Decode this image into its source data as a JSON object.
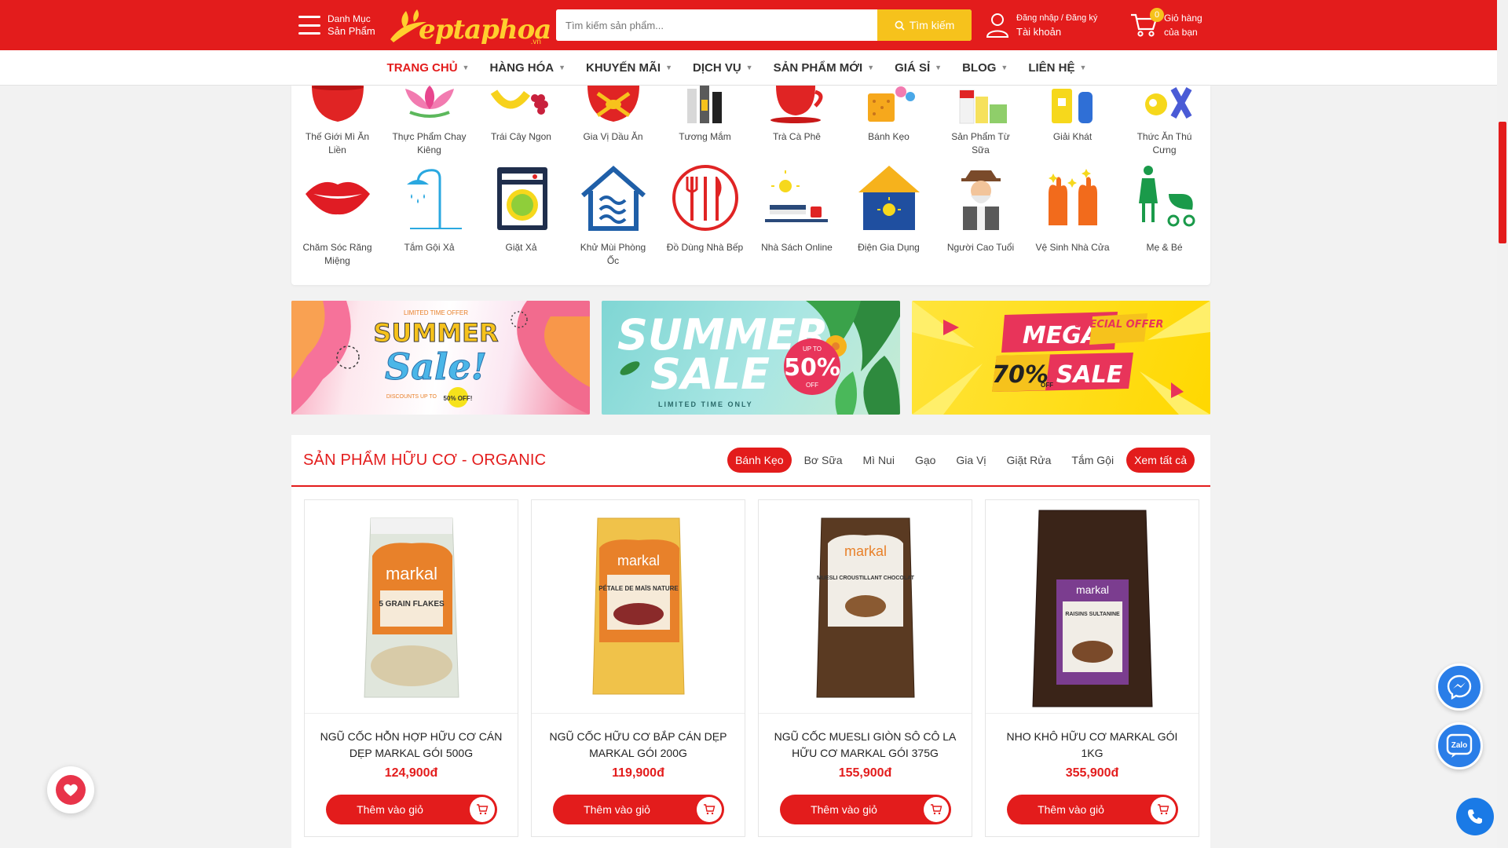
{
  "header": {
    "menu_line1": "Danh Mục",
    "menu_line2": "Sản Phẩm",
    "logo_text": "eptaphoa",
    "logo_suffix": ".vn",
    "search_placeholder": "Tìm kiếm sản phẩm...",
    "search_button": "Tìm kiếm",
    "account_line1": "Đăng nhập / Đăng ký",
    "account_line2": "Tài khoản",
    "cart_count": "0",
    "cart_line1": "Giỏ hàng",
    "cart_line2": "của bạn"
  },
  "nav": {
    "items": [
      {
        "label": "TRANG CHỦ"
      },
      {
        "label": "HÀNG HÓA"
      },
      {
        "label": "KHUYẾN MÃI"
      },
      {
        "label": "DỊCH VỤ"
      },
      {
        "label": "SẢN PHẨM MỚI"
      },
      {
        "label": "GIÁ SỈ"
      },
      {
        "label": "BLOG"
      },
      {
        "label": "LIÊN HỆ"
      }
    ]
  },
  "categories": {
    "row1": [
      {
        "label": "Thế Giới Mì Ăn Liền",
        "icon": "noodle-bowl-icon"
      },
      {
        "label": "Thực Phẩm Chay Kiêng",
        "icon": "lotus-icon"
      },
      {
        "label": "Trái Cây Ngon",
        "icon": "fruit-icon"
      },
      {
        "label": "Gia Vị Dầu Ăn",
        "icon": "spice-icon"
      },
      {
        "label": "Tương Mắm",
        "icon": "sauce-bottle-icon"
      },
      {
        "label": "Trà Cà Phê",
        "icon": "tea-cup-icon"
      },
      {
        "label": "Bánh Kẹo",
        "icon": "candy-icon"
      },
      {
        "label": "Sản Phẩm Từ Sữa",
        "icon": "milk-icon"
      },
      {
        "label": "Giải Khát",
        "icon": "drink-icon"
      },
      {
        "label": "Thức Ăn Thú Cưng",
        "icon": "pet-food-icon"
      }
    ],
    "row2": [
      {
        "label": "Chăm Sóc Răng Miệng",
        "icon": "lips-icon"
      },
      {
        "label": "Tắm Gội Xả",
        "icon": "shower-icon"
      },
      {
        "label": "Giặt Xả",
        "icon": "washing-machine-icon"
      },
      {
        "label": "Khử Mùi Phòng Ốc",
        "icon": "house-icon"
      },
      {
        "label": "Đồ Dùng Nhà Bếp",
        "icon": "cutlery-icon"
      },
      {
        "label": "Nhà Sách Online",
        "icon": "book-icon"
      },
      {
        "label": "Điện Gia Dụng",
        "icon": "lamp-icon"
      },
      {
        "label": "Người Cao Tuổi",
        "icon": "elderly-icon"
      },
      {
        "label": "Vệ Sinh Nhà Cửa",
        "icon": "gloves-icon"
      },
      {
        "label": "Mẹ & Bé",
        "icon": "stroller-icon"
      }
    ]
  },
  "banners": {
    "b1": {
      "tag": "LIMITED TIME OFFER",
      "title1": "SUMMER",
      "title2": "Sale!",
      "note": "DISCOUNTS UP TO",
      "badge": "50% OFF!"
    },
    "b2": {
      "title1": "SUMMER",
      "title2": "SALE",
      "upto": "UP TO",
      "pct": "50%",
      "off": "OFF",
      "note": "LIMITED TIME ONLY"
    },
    "b3": {
      "mega": "MEGA",
      "special": "SPECIAL OFFER",
      "pct": "70%",
      "off": "OFF",
      "sale": "SALE"
    }
  },
  "organic": {
    "title": "SẢN PHẨM HỮU CƠ - ORGANIC",
    "tabs": [
      "Bánh Kẹo",
      "Bơ Sữa",
      "Mì Nui",
      "Gạo",
      "Gia Vị",
      "Giặt Rửa",
      "Tắm Gội"
    ],
    "view_all": "Xem tất cả",
    "add_to_cart": "Thêm vào giỏ",
    "products": [
      {
        "name": "NGŨ CỐC HỖN HỢP HỮU CƠ CÁN DẸP MARKAL GÓI 500G",
        "price": "124,900đ",
        "brand": "markal",
        "pack": "5 GRAIN FLAKES",
        "color": "#e0e6dc",
        "label_color": "#e8812a"
      },
      {
        "name": "NGŨ CỐC HỮU CƠ BẮP CÁN DẸP MARKAL GÓI 200G",
        "price": "119,900đ",
        "brand": "markal",
        "pack": "PÉTALE DE MAÏS NATURE",
        "color": "#f0c24a",
        "label_color": "#e8812a"
      },
      {
        "name": "NGŨ CỐC MUESLI GIÒN SÔ CÔ LA HỮU CƠ MARKAL GÓI 375G",
        "price": "155,900đ",
        "brand": "markal",
        "pack": "MUESLI CROUSTILLANT CHOCOLAT",
        "color": "#5a3a22",
        "label_color": "#f1ede6"
      },
      {
        "name": "NHO KHÔ HỮU CƠ MARKAL GÓI 1KG",
        "price": "355,900đ",
        "brand": "markal",
        "pack": "RAISINS SULTANINE",
        "color": "#3a2418",
        "label_color": "#7b3d8f"
      }
    ]
  },
  "floating": {
    "zalo_label": "Zalo"
  },
  "colors": {
    "primary": "#e31c1c",
    "accent": "#f6c21c"
  }
}
